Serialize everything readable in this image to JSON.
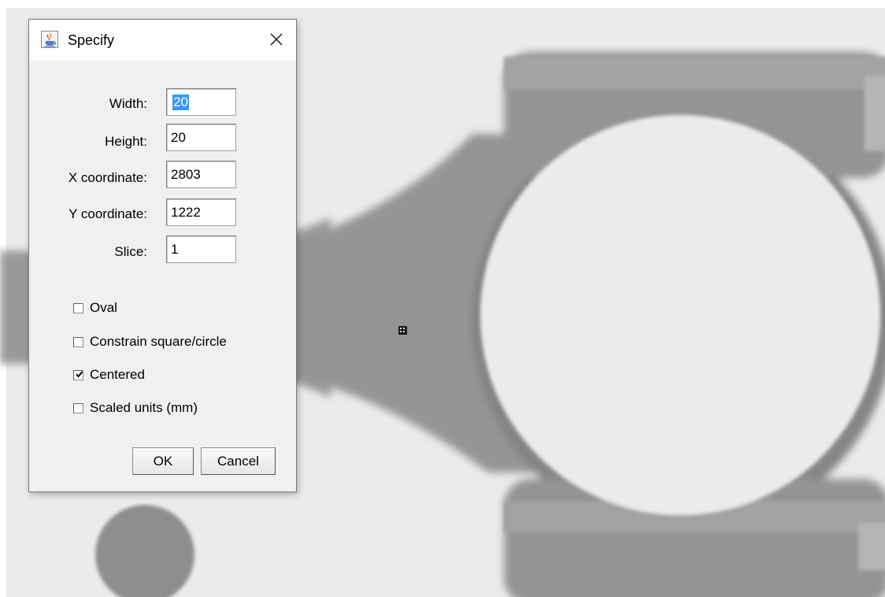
{
  "window": {
    "title": "Specify",
    "title_icon": "java-cup-icon",
    "close_icon": "close-icon"
  },
  "fields": [
    {
      "label": "Width:",
      "value": "20"
    },
    {
      "label": "Height:",
      "value": "20"
    },
    {
      "label": "X coordinate:",
      "value": "2803"
    },
    {
      "label": "Y coordinate:",
      "value": "1222"
    },
    {
      "label": "Slice:",
      "value": "1"
    }
  ],
  "checkboxes": [
    {
      "label": "Oval",
      "checked": false
    },
    {
      "label": "Constrain square/circle",
      "checked": false
    },
    {
      "label": "Centered",
      "checked": true
    },
    {
      "label": "Scaled units (mm)",
      "checked": false
    }
  ],
  "buttons": {
    "ok": "OK",
    "cancel": "Cancel"
  },
  "background": {
    "type": "x-ray-image",
    "color": "#ebebeb",
    "object_color": "#8a8a8a"
  }
}
